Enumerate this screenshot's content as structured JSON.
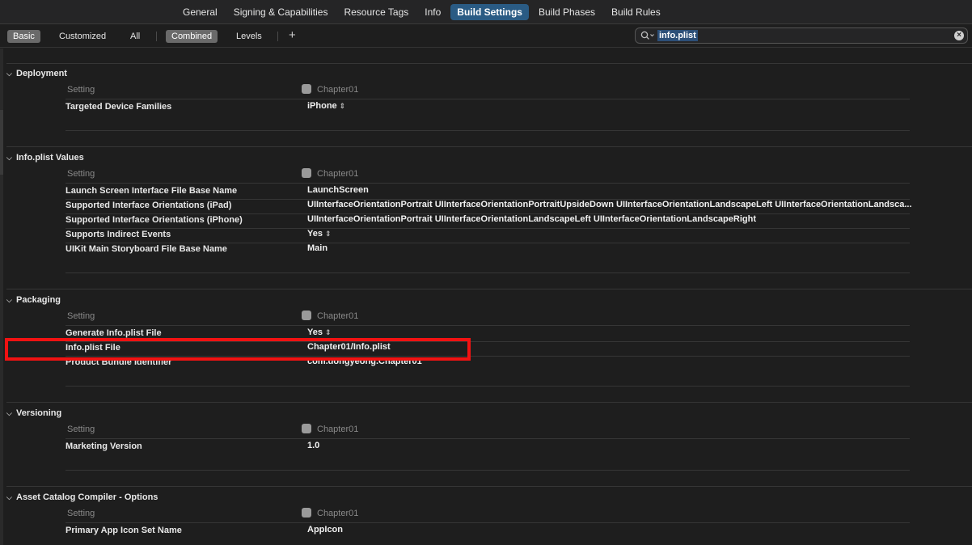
{
  "tabs": [
    "General",
    "Signing & Capabilities",
    "Resource Tags",
    "Info",
    "Build Settings",
    "Build Phases",
    "Build Rules"
  ],
  "active_tab": "Build Settings",
  "filter": {
    "basic": "Basic",
    "customized": "Customized",
    "all": "All",
    "combined": "Combined",
    "levels": "Levels",
    "add": "+"
  },
  "search": {
    "value": "info.plist",
    "clear": "×"
  },
  "column_header": "Setting",
  "target": "Chapter01",
  "sections": {
    "deployment": {
      "title": "Deployment",
      "rows": [
        {
          "name": "Targeted Device Families",
          "value": "iPhone"
        }
      ]
    },
    "infoplist": {
      "title": "Info.plist Values",
      "rows": [
        {
          "name": "Launch Screen Interface File Base Name",
          "value": "LaunchScreen"
        },
        {
          "name": "Supported Interface Orientations (iPad)",
          "value": "UIInterfaceOrientationPortrait UIInterfaceOrientationPortraitUpsideDown UIInterfaceOrientationLandscapeLeft UIInterfaceOrientationLandsca..."
        },
        {
          "name": "Supported Interface Orientations (iPhone)",
          "value": "UIInterfaceOrientationPortrait UIInterfaceOrientationLandscapeLeft UIInterfaceOrientationLandscapeRight"
        },
        {
          "name": "Supports Indirect Events",
          "value": "Yes"
        },
        {
          "name": "UIKit Main Storyboard File Base Name",
          "value": "Main"
        }
      ]
    },
    "packaging": {
      "title": "Packaging",
      "rows": [
        {
          "name": "Generate Info.plist File",
          "value": "Yes"
        },
        {
          "name": "Info.plist File",
          "value": "Chapter01/Info.plist"
        },
        {
          "name": "Product Bundle Identifier",
          "value": "com.dongyeong.Chapter01"
        }
      ]
    },
    "versioning": {
      "title": "Versioning",
      "rows": [
        {
          "name": "Marketing Version",
          "value": "1.0"
        }
      ]
    },
    "assetcatalog": {
      "title": "Asset Catalog Compiler - Options",
      "rows": [
        {
          "name": "Primary App Icon Set Name",
          "value": "AppIcon"
        }
      ]
    }
  },
  "colors": {
    "accent_tab": "#2a5b84",
    "highlight_box": "#f11212",
    "selected_filter": "#6a6a6a"
  }
}
